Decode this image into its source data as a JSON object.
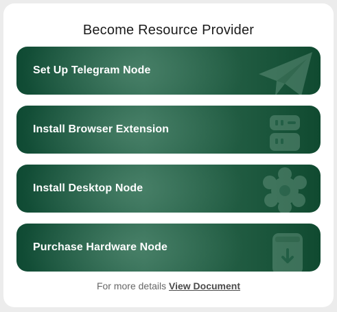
{
  "title": "Become Resource Provider",
  "options": [
    {
      "label": "Set Up Telegram Node",
      "icon": "paper-plane-icon"
    },
    {
      "label": "Install Browser Extension",
      "icon": "server-icon"
    },
    {
      "label": "Install Desktop Node",
      "icon": "gear-icon"
    },
    {
      "label": "Purchase Hardware Node",
      "icon": "hardware-device-icon"
    }
  ],
  "footer": {
    "text": "For more details",
    "link_label": "View Document"
  },
  "colors": {
    "card_bg": "#ffffff",
    "option_green": "#1f5a40",
    "option_green_dark": "#0f4a33",
    "footer_text": "#666666"
  }
}
